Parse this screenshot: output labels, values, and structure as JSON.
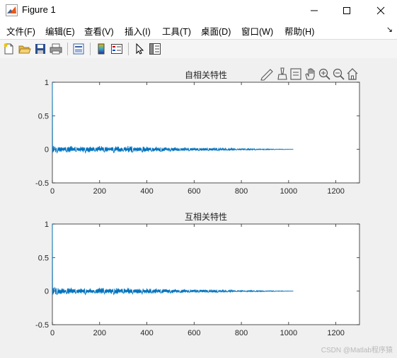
{
  "window": {
    "title": "Figure 1"
  },
  "menu": {
    "items": [
      "文件(F)",
      "编辑(E)",
      "查看(V)",
      "插入(I)",
      "工具(T)",
      "桌面(D)",
      "窗口(W)",
      "帮助(H)"
    ]
  },
  "toolbar": {
    "icons": [
      "new-figure-icon",
      "open-file-icon",
      "save-icon",
      "print-icon",
      "print-preview-icon",
      "insert-colorbar-icon",
      "insert-legend-icon",
      "pointer-icon",
      "plot-browser-icon"
    ]
  },
  "axes_toolbar": {
    "icons": [
      "edit-plot-icon",
      "brush-icon",
      "data-tips-icon",
      "pan-icon",
      "zoom-in-icon",
      "zoom-out-icon",
      "home-icon"
    ]
  },
  "colors": {
    "series": "#0072bd",
    "axes_bg": "#ffffff",
    "figure_bg": "#f0f0f0"
  },
  "chart_data": [
    {
      "type": "line",
      "title": "自相关特性",
      "xlim": [
        0,
        1300
      ],
      "ylim": [
        -0.5,
        1
      ],
      "xticks": [
        0,
        200,
        400,
        600,
        800,
        1000,
        1200
      ],
      "yticks": [
        -0.5,
        0,
        0.5,
        1
      ],
      "xtick_labels": [
        "0",
        "200",
        "400",
        "600",
        "800",
        "1000",
        "1200"
      ],
      "ytick_labels": [
        "-0.5",
        "0",
        "0.5",
        "1"
      ],
      "grid": false,
      "series": [
        {
          "x": [
            0,
            1,
            2,
            3,
            4,
            6,
            10,
            20,
            40,
            60,
            80,
            100,
            120,
            140,
            160,
            180,
            200,
            220,
            240,
            260,
            280,
            300,
            320,
            340,
            360,
            380,
            400,
            420,
            440,
            460,
            480,
            500,
            520,
            540,
            560,
            580,
            600,
            620,
            640,
            660,
            680,
            700,
            720,
            740,
            760,
            780,
            800,
            820,
            840,
            860,
            880,
            900,
            920,
            940,
            960,
            980,
            1000,
            1020
          ],
          "y": [
            1,
            -0.05,
            0.02,
            -0.04,
            0.05,
            -0.03,
            0.04,
            -0.05,
            0.03,
            -0.04,
            0.05,
            -0.03,
            0.04,
            -0.05,
            0.04,
            -0.03,
            0.05,
            -0.04,
            0.03,
            -0.05,
            0.04,
            -0.03,
            0.05,
            -0.04,
            0.03,
            -0.04,
            0.04,
            -0.03,
            0.04,
            -0.03,
            0.03,
            -0.03,
            0.03,
            -0.02,
            0.03,
            -0.02,
            0.02,
            -0.02,
            0.02,
            -0.02,
            0.02,
            -0.02,
            0.015,
            -0.015,
            0.015,
            -0.01,
            0.01,
            -0.01,
            0.01,
            -0.01,
            0.008,
            -0.008,
            0.006,
            -0.006,
            0.004,
            -0.004,
            0.002,
            0
          ]
        }
      ]
    },
    {
      "type": "line",
      "title": "互相关特性",
      "xlim": [
        0,
        1300
      ],
      "ylim": [
        -0.5,
        1
      ],
      "xticks": [
        0,
        200,
        400,
        600,
        800,
        1000,
        1200
      ],
      "yticks": [
        -0.5,
        0,
        0.5,
        1
      ],
      "xtick_labels": [
        "0",
        "200",
        "400",
        "600",
        "800",
        "1000",
        "1200"
      ],
      "ytick_labels": [
        "-0.5",
        "0",
        "0.5",
        "1"
      ],
      "grid": false,
      "series": [
        {
          "x": [
            0,
            1,
            2,
            3,
            4,
            6,
            10,
            20,
            40,
            60,
            80,
            100,
            120,
            140,
            160,
            180,
            200,
            220,
            240,
            260,
            280,
            300,
            320,
            340,
            360,
            380,
            400,
            420,
            440,
            460,
            480,
            500,
            520,
            540,
            560,
            580,
            600,
            620,
            640,
            660,
            680,
            700,
            720,
            740,
            760,
            780,
            800,
            820,
            840,
            860,
            880,
            900,
            920,
            940,
            960,
            980,
            1000,
            1020
          ],
          "y": [
            1,
            -0.05,
            0.03,
            -0.05,
            0.05,
            -0.03,
            0.05,
            -0.05,
            0.04,
            -0.04,
            0.05,
            -0.03,
            0.04,
            -0.05,
            0.04,
            -0.03,
            0.05,
            -0.04,
            0.03,
            -0.05,
            0.04,
            -0.03,
            0.05,
            -0.04,
            0.03,
            -0.04,
            0.04,
            -0.03,
            0.04,
            -0.03,
            0.03,
            -0.03,
            0.03,
            -0.02,
            0.03,
            -0.02,
            0.02,
            -0.02,
            0.02,
            -0.02,
            0.02,
            -0.02,
            0.015,
            -0.015,
            0.015,
            -0.01,
            0.01,
            -0.01,
            0.01,
            -0.01,
            0.008,
            -0.008,
            0.006,
            -0.006,
            0.004,
            -0.004,
            0.002,
            0
          ]
        }
      ]
    }
  ],
  "watermark": "CSDN @Matlab程序猿"
}
